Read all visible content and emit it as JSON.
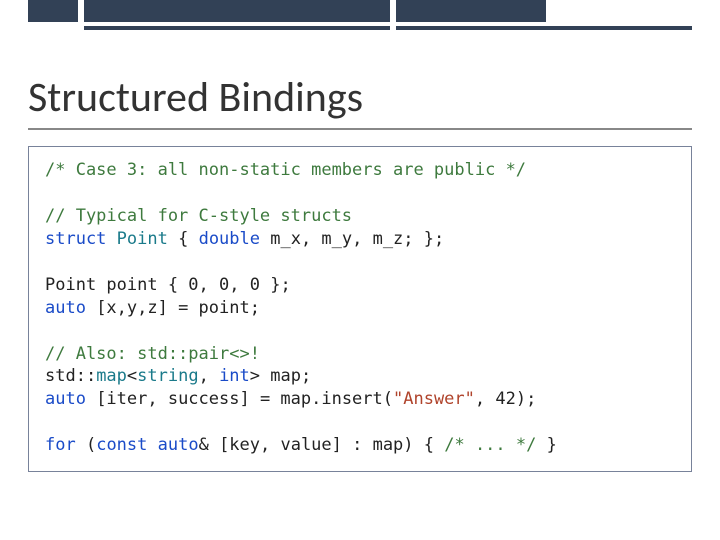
{
  "title": "Structured Bindings",
  "code": {
    "l1_cmt": "/* Case 3: all non-static members are public */",
    "l3_cmt": "// Typical for C-style structs",
    "l4_kw1": "struct",
    "l4_ty": "Point",
    "l4_mid": " { ",
    "l4_kw2": "double",
    "l4_rest": " m_x, m_y, m_z; };",
    "l6_pre": "Point point { ",
    "l6_n1": "0",
    "l6_sep": ", ",
    "l6_n2": "0",
    "l6_n3": "0",
    "l6_post": " };",
    "l7_kw": "auto",
    "l7_rest": " [x,y,z] = point;",
    "l9_cmt": "// Also: std::pair<>!",
    "l10_pre": "std::",
    "l10_tpl": "map",
    "l10_lt": "<",
    "l10_str": "string",
    "l10_sep": ", ",
    "l10_int": "int",
    "l10_post": "> map;",
    "l11_kw": "auto",
    "l11_mid": " [iter, success] = map.insert(",
    "l11_s": "\"Answer\"",
    "l11_sepn": ", ",
    "l11_n": "42",
    "l11_end": ");",
    "l13_for": "for",
    "l13_a": " (",
    "l13_const": "const",
    "l13_s1": " ",
    "l13_auto": "auto",
    "l13_b": "& [key, value] : map) { ",
    "l13_cmt": "/* ... */",
    "l13_c": " }"
  }
}
